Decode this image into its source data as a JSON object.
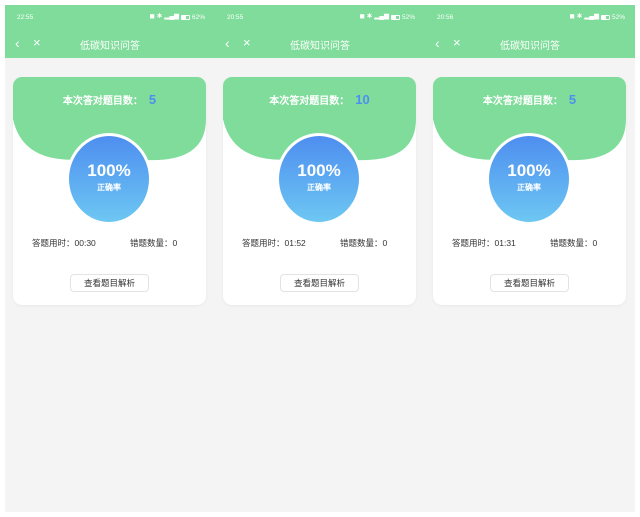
{
  "colors": {
    "accent_green": "#7fdc9a",
    "score_blue": "#4d8ff0",
    "circle_top": "#4e8ef0",
    "circle_bottom": "#6dc7f2"
  },
  "screens": [
    {
      "status": {
        "time": "22:55",
        "battery": "62%"
      },
      "header": {
        "back_icon": "‹",
        "close_icon": "×",
        "title": "低碳知识问答"
      },
      "result": {
        "score_label": "本次答对题目数：",
        "score_value": "5",
        "accuracy": "100%",
        "accuracy_label": "正确率",
        "time_label": "答题用时：",
        "time_value": "00:30",
        "wrong_label": "错题数量：",
        "wrong_value": "0",
        "review_button": "查看题目解析"
      }
    },
    {
      "status": {
        "time": "20:55",
        "battery": "52%"
      },
      "header": {
        "back_icon": "‹",
        "close_icon": "×",
        "title": "低碳知识问答"
      },
      "result": {
        "score_label": "本次答对题目数：",
        "score_value": "10",
        "accuracy": "100%",
        "accuracy_label": "正确率",
        "time_label": "答题用时：",
        "time_value": "01:52",
        "wrong_label": "错题数量：",
        "wrong_value": "0",
        "review_button": "查看题目解析"
      }
    },
    {
      "status": {
        "time": "20:56",
        "battery": "52%"
      },
      "header": {
        "back_icon": "‹",
        "close_icon": "×",
        "title": "低碳知识问答"
      },
      "result": {
        "score_label": "本次答对题目数：",
        "score_value": "5",
        "accuracy": "100%",
        "accuracy_label": "正确率",
        "time_label": "答题用时：",
        "time_value": "01:31",
        "wrong_label": "错题数量：",
        "wrong_value": "0",
        "review_button": "查看题目解析"
      }
    }
  ]
}
